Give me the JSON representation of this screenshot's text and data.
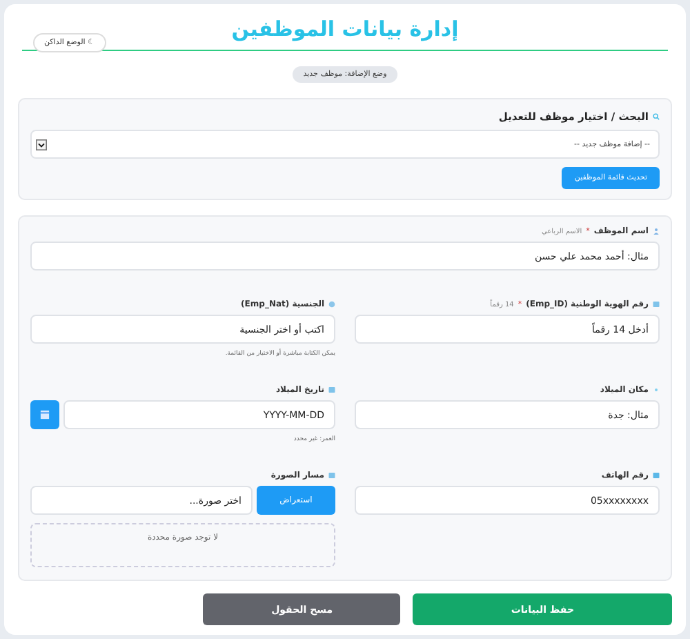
{
  "header": {
    "title": "إدارة بيانات الموظفين",
    "theme_toggle": "☾ الوضع الداكن",
    "mode_badge": "وضع الإضافة: موظف جديد"
  },
  "search": {
    "heading": "البحث / اختيار موظف للتعديل",
    "select_value": "-- إضافة موظف جديد --",
    "refresh_button": "تحديث قائمة الموظفين"
  },
  "name_field": {
    "label": "اسم الموظف",
    "required_mark": "*",
    "hint": "الاسم الرباعي",
    "placeholder": "مثال: أحمد محمد علي حسن"
  },
  "fields": [
    {
      "kind": "text",
      "label": "رقم الهوية الوطنية (Emp_ID)",
      "required_mark": "*",
      "hint": "14 رقماً",
      "placeholder": "أدخل 14 رقماً"
    },
    {
      "kind": "text",
      "label": "الجنسية (Emp_Nat)",
      "placeholder": "اكتب أو اختر الجنسية",
      "note": "يمكن الكتابة مباشرة أو الاختيار من القائمة."
    },
    {
      "kind": "text",
      "label": "مكان الميلاد",
      "placeholder": "مثال: جدة"
    },
    {
      "kind": "date",
      "label": "تاريخ الميلاد",
      "placeholder": "YYYY-MM-DD",
      "note": "العمر: غير محدد"
    },
    {
      "kind": "text",
      "label": "رقم الهاتف",
      "placeholder": "05xxxxxxxx"
    },
    {
      "kind": "file",
      "label": "مسار الصورة",
      "browse_button": "استعراض",
      "placeholder": "اختر صورة...",
      "preview": "لا توجد صورة محددة"
    }
  ],
  "actions": {
    "save": "حفظ البيانات",
    "clear": "مسح الحقول"
  }
}
